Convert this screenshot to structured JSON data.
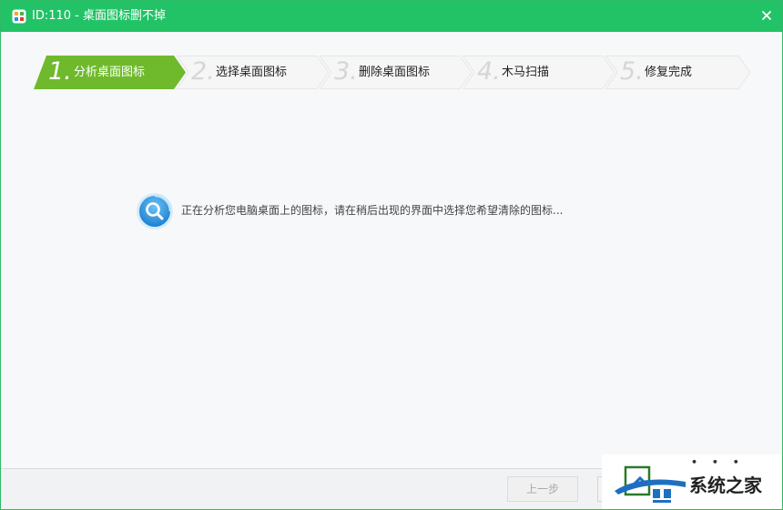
{
  "window": {
    "title": "ID:110 - 桌面图标删不掉",
    "close_label": "×"
  },
  "steps": [
    {
      "number": "1.",
      "label": "分析桌面图标",
      "state": "active"
    },
    {
      "number": "2.",
      "label": "选择桌面图标",
      "state": "pending"
    },
    {
      "number": "3.",
      "label": "删除桌面图标",
      "state": "pending"
    },
    {
      "number": "4.",
      "label": "木马扫描",
      "state": "pending"
    },
    {
      "number": "5.",
      "label": "修复完成",
      "state": "pending"
    }
  ],
  "status": {
    "icon": "search-icon",
    "text": "正在分析您电脑桌面上的图标，请在稍后出现的界面中选择您希望清除的图标..."
  },
  "footer": {
    "prev_label": "上一步"
  },
  "watermark": {
    "text": "系统之家",
    "dots": "• • •"
  },
  "colors": {
    "titlebar": "#22c366",
    "active_step": "#6fba2c",
    "pending_step": "#f6f6f6",
    "status_icon": "#2f8fd8"
  }
}
